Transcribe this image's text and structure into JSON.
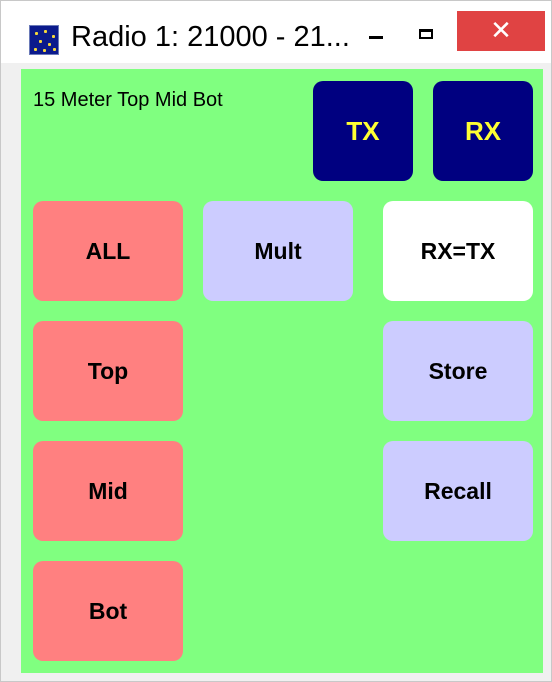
{
  "window": {
    "title": "Radio 1: 21000 - 21...",
    "close_glyph": "✕"
  },
  "status": {
    "label": "15 Meter Top Mid Bot"
  },
  "buttons": {
    "tx": "TX",
    "rx": "RX",
    "all": "ALL",
    "mult": "Mult",
    "rx_eq_tx": "RX=TX",
    "top": "Top",
    "store": "Store",
    "mid": "Mid",
    "recall": "Recall",
    "bot": "Bot"
  },
  "colors": {
    "client_background": "#80ff80",
    "txrx_background": "#000080",
    "txrx_text": "#ffff33",
    "band_button": "#ff8080",
    "memory_button": "#ccccff",
    "rx_eq_tx_button": "#ffffff",
    "close_button": "#e04343"
  },
  "icons": {
    "app": "starfield-app-icon",
    "minimize": "minimize-icon",
    "maximize": "maximize-icon",
    "close": "close-icon"
  }
}
